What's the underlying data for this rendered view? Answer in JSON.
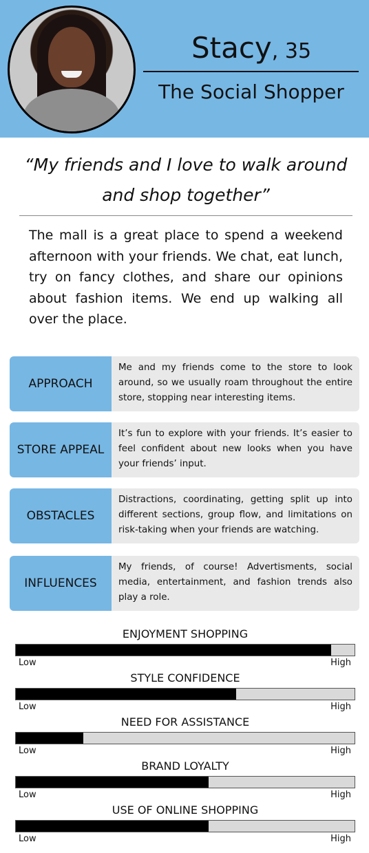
{
  "persona": {
    "name": "Stacy",
    "age": ", 35",
    "title": "The Social Shopper",
    "quote": "“My friends and I love to walk around and shop together”",
    "bio": "The mall is a great place to spend a weekend afternoon with your friends. We chat, eat lunch, try on fancy clothes, and share our opinions about fashion items. We end up walking all over the place."
  },
  "cards": [
    {
      "label": "APPROACH",
      "text": "Me and my friends come to the store to look around, so we usually roam throughout the entire store, stopping near interesting items."
    },
    {
      "label": "STORE APPEAL",
      "text": "It’s fun to explore with your friends. It’s easier to feel confident about new looks when you have your friends’ input."
    },
    {
      "label": "OBSTACLES",
      "text": "Distractions, coordinating, getting split up into different sections, group flow, and limitations on risk-taking when your friends are watching."
    },
    {
      "label": "INFLUENCES",
      "text": "My friends, of course! Advertisments, social media, entertainment, and fashion trends also play a role."
    }
  ],
  "meters": [
    {
      "title": "ENJOYMENT SHOPPING",
      "low": "Low",
      "high": "High",
      "value": 0.93
    },
    {
      "title": "STYLE CONFIDENCE",
      "low": "Low",
      "high": "High",
      "value": 0.65
    },
    {
      "title": "NEED FOR ASSISTANCE",
      "low": "Low",
      "high": "High",
      "value": 0.2
    },
    {
      "title": "BRAND LOYALTY",
      "low": "Low",
      "high": "High",
      "value": 0.57
    },
    {
      "title": "USE OF ONLINE SHOPPING",
      "low": "Low",
      "high": "High",
      "value": 0.57
    }
  ],
  "colors": {
    "header": "#77b7e4",
    "card_label": "#77b7e4",
    "card_text": "#e9e9e9",
    "meter_fill": "#000000",
    "meter_track": "#d9d9d9"
  }
}
